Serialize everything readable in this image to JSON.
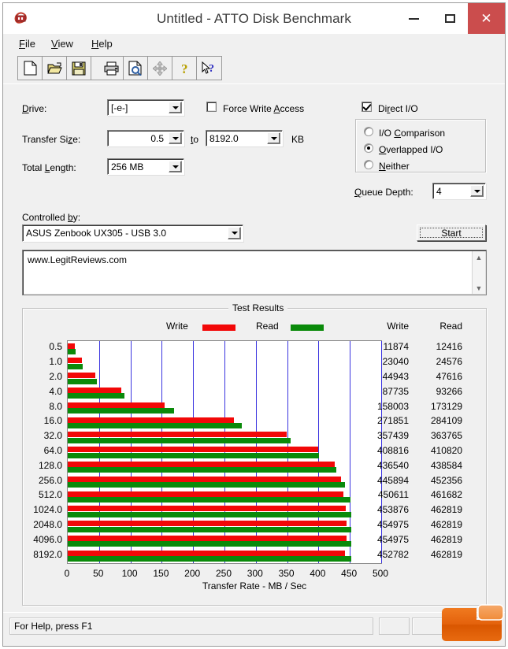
{
  "window": {
    "title": "Untitled - ATTO Disk Benchmark",
    "app_icon": "atto-lock-icon",
    "controls": {
      "minimize": "minimize-icon",
      "maximize": "maximize-icon",
      "close": "close-icon",
      "close_color": "#cb4d4d"
    }
  },
  "menu": [
    {
      "label": "File",
      "accel": "F"
    },
    {
      "label": "View",
      "accel": "V"
    },
    {
      "label": "Help",
      "accel": "H"
    }
  ],
  "toolbar": [
    {
      "name": "new-document-icon",
      "tip": "New"
    },
    {
      "name": "open-folder-icon",
      "tip": "Open"
    },
    {
      "name": "save-disk-icon",
      "tip": "Save"
    },
    {
      "name": "print-icon",
      "tip": "Print"
    },
    {
      "name": "print-preview-icon",
      "tip": "Print Preview"
    },
    {
      "name": "move-arrows-icon",
      "tip": "Move"
    },
    {
      "name": "help-question-icon",
      "tip": "Help"
    },
    {
      "name": "context-help-icon",
      "tip": "Context Help"
    }
  ],
  "settings": {
    "drive_label": "Drive:",
    "drive_value": "[-e-]",
    "transfer_size_label": "Transfer Size:",
    "transfer_size_from": "0.5",
    "to_label": "to",
    "transfer_size_to": "8192.0",
    "kb_label": "KB",
    "total_length_label": "Total Length:",
    "total_length_value": "256 MB",
    "force_write_label": "Force Write Access",
    "force_write_checked": false,
    "direct_io_label": "Direct I/O",
    "direct_io_checked": true,
    "io_options": [
      {
        "label": "I/O Comparison",
        "selected": false
      },
      {
        "label": "Overlapped I/O",
        "selected": true
      },
      {
        "label": "Neither",
        "selected": false
      }
    ],
    "queue_depth_label": "Queue Depth:",
    "queue_depth_value": "4",
    "controlled_by_label": "Controlled by:",
    "controlled_by_value": "ASUS Zenbook UX305 - USB 3.0",
    "start_label": "Start"
  },
  "log": {
    "text": "www.LegitReviews.com"
  },
  "results": {
    "group_title": "Test Results",
    "legend": [
      {
        "label": "Write",
        "color": "#f20808"
      },
      {
        "label": "Read",
        "color": "#0a8a0a"
      }
    ],
    "columns": [
      "Write",
      "Read"
    ]
  },
  "statusbar": {
    "hint": "For Help, press F1"
  },
  "chart_data": {
    "type": "bar",
    "orientation": "horizontal",
    "title": "Test Results",
    "xlabel": "Transfer Rate - MB / Sec",
    "ylabel": "",
    "xlim": [
      0,
      500
    ],
    "xticks": [
      0,
      50,
      100,
      150,
      200,
      250,
      300,
      350,
      400,
      450,
      500
    ],
    "grid": true,
    "legend_position": "top",
    "categories": [
      "0.5",
      "1.0",
      "2.0",
      "4.0",
      "8.0",
      "16.0",
      "32.0",
      "64.0",
      "128.0",
      "256.0",
      "512.0",
      "1024.0",
      "2048.0",
      "4096.0",
      "8192.0"
    ],
    "series": [
      {
        "name": "Write",
        "color": "#f20808",
        "unit": "KB/s",
        "values": [
          11874,
          23040,
          44943,
          87735,
          158003,
          271851,
          357439,
          408816,
          436540,
          445894,
          450611,
          453876,
          454975,
          454975,
          452782
        ]
      },
      {
        "name": "Read",
        "color": "#0a8a0a",
        "unit": "KB/s",
        "values": [
          12416,
          24576,
          47616,
          93266,
          173129,
          284109,
          363765,
          410820,
          438584,
          452356,
          461682,
          462819,
          462819,
          462819,
          462819
        ]
      }
    ]
  }
}
